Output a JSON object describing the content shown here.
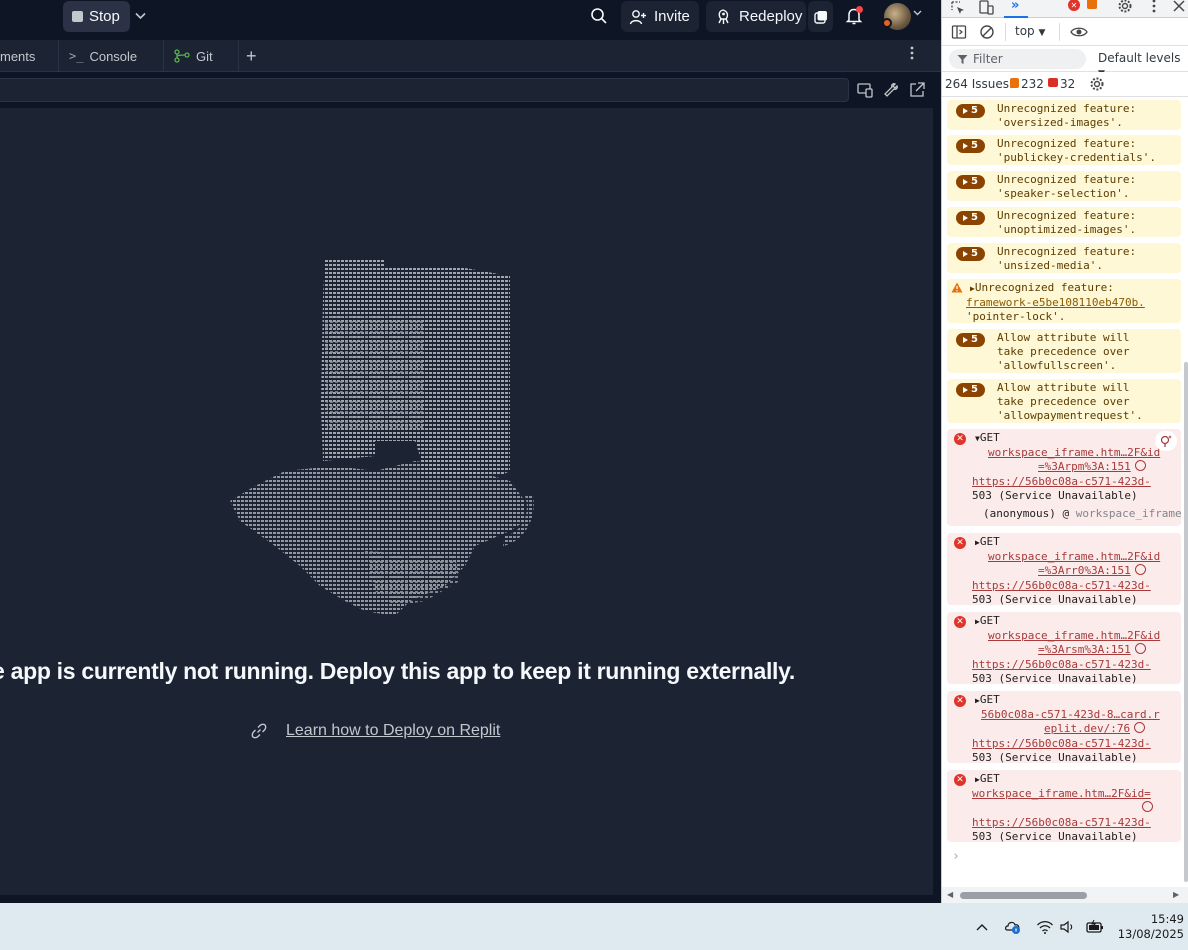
{
  "topbar": {
    "stop_label": "Stop",
    "invite_label": "Invite",
    "redeploy_label": "Redeploy"
  },
  "tabs": [
    {
      "label": "ments"
    },
    {
      "label": "Console"
    },
    {
      "label": "Git"
    }
  ],
  "preview": {
    "message": "e app is currently not running. Deploy this app to keep it running externally.",
    "learn_link": "Learn how to Deploy on Replit"
  },
  "devtools": {
    "context": "top",
    "filter_placeholder": "Filter",
    "levels_label": "Default levels",
    "issues_label": "264 Issues:",
    "issues_warn_count": "232",
    "issues_info_count": "32",
    "warnings": [
      {
        "count": "5",
        "lines": [
          "Unrecognized feature:",
          "'oversized-images'."
        ]
      },
      {
        "count": "5",
        "lines": [
          "Unrecognized feature:",
          "'publickey-credentials'."
        ]
      },
      {
        "count": "5",
        "lines": [
          "Unrecognized feature:",
          "'speaker-selection'."
        ]
      },
      {
        "count": "5",
        "lines": [
          "Unrecognized feature:",
          "'unoptimized-images'."
        ]
      },
      {
        "count": "5",
        "lines": [
          "Unrecognized feature:",
          "'unsized-media'."
        ]
      }
    ],
    "single_warning": {
      "title": "Unrecognized feature:",
      "link": "framework-e5be108110eb470b.",
      "value": "'pointer-lock'."
    },
    "allow_warnings": [
      {
        "count": "5",
        "lines": [
          "Allow attribute will",
          "take precedence over",
          "'allowfullscreen'."
        ]
      },
      {
        "count": "5",
        "lines": [
          "Allow attribute will",
          "take precedence over",
          "'allowpaymentrequest'."
        ]
      }
    ],
    "errors": [
      {
        "method": "GET",
        "link1": "workspace_iframe.htm…2F&id",
        "link2": "=%3Arpm%3A:151",
        "url": "https://56b0c08a-c571-423d-",
        "status": "503 (Service Unavailable)",
        "stack": "(anonymous) @ ",
        "stack_link": "workspace_iframe."
      },
      {
        "method": "GET",
        "link1": "workspace_iframe.htm…2F&id",
        "link2": "=%3Arr0%3A:151",
        "url": "https://56b0c08a-c571-423d-",
        "status": "503 (Service Unavailable)"
      },
      {
        "method": "GET",
        "link1": "workspace_iframe.htm…2F&id",
        "link2": "=%3Arsm%3A:151",
        "url": "https://56b0c08a-c571-423d-",
        "status": "503 (Service Unavailable)"
      },
      {
        "method": "GET",
        "link1": "56b0c08a-c571-423d-8…card.r",
        "link2": "eplit.dev/:76",
        "url": "https://56b0c08a-c571-423d-",
        "status": "503 (Service Unavailable)"
      },
      {
        "method": "GET",
        "link1": "workspace_iframe.htm…2F&id=",
        "url": "https://56b0c08a-c571-423d-",
        "status": "503 (Service Unavailable)"
      }
    ]
  },
  "taskbar": {
    "time": "15:49",
    "date": "13/08/2025"
  }
}
